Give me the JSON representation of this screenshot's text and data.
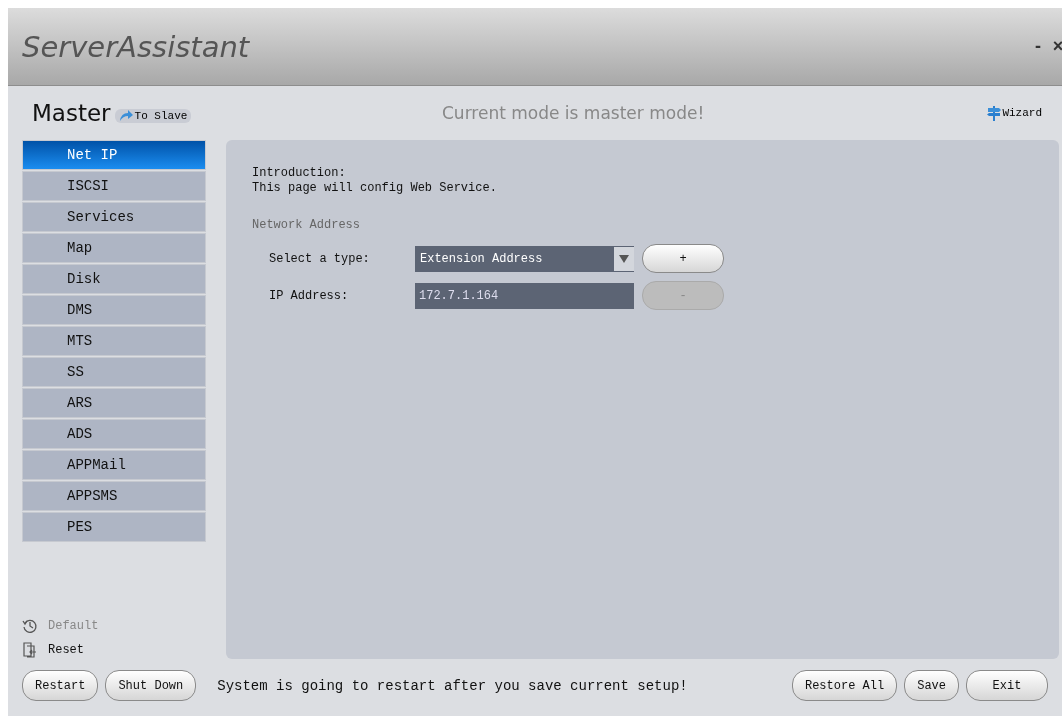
{
  "window": {
    "title": "ServerAssistant",
    "controls": [
      "-",
      "×"
    ]
  },
  "header": {
    "mode": "Master",
    "switch_link": "To Slave",
    "status": "Current mode is master mode!",
    "wizard": "Wizard"
  },
  "sidebar": {
    "items": [
      {
        "label": "Net IP",
        "selected": true
      },
      {
        "label": "ISCSI",
        "selected": false
      },
      {
        "label": "Services",
        "selected": false
      },
      {
        "label": "Map",
        "selected": false
      },
      {
        "label": "Disk",
        "selected": false
      },
      {
        "label": "DMS",
        "selected": false
      },
      {
        "label": "MTS",
        "selected": false
      },
      {
        "label": "SS",
        "selected": false
      },
      {
        "label": "ARS",
        "selected": false
      },
      {
        "label": "ADS",
        "selected": false
      },
      {
        "label": "APPMail",
        "selected": false
      },
      {
        "label": "APPSMS",
        "selected": false
      },
      {
        "label": "PES",
        "selected": false
      }
    ],
    "actions": [
      {
        "kind": "history",
        "label": "Default",
        "disabled": true
      },
      {
        "kind": "reset",
        "label": "Reset",
        "disabled": false
      }
    ]
  },
  "content": {
    "intro_title": "Introduction:",
    "intro_text": "This page will config Web Service.",
    "section": "Network Address",
    "rows": [
      {
        "kind": "select",
        "label": "Select a type:",
        "value": "Extension Address",
        "button": "+",
        "button_disabled": false
      },
      {
        "kind": "input",
        "label": "IP Address:",
        "value": "172.7.1.164",
        "button": "-",
        "button_disabled": true
      }
    ]
  },
  "footer": {
    "left_buttons": [
      "Restart",
      "Shut Down"
    ],
    "message": "System is going to restart after you save current setup!",
    "right_buttons": [
      "Restore All",
      "Save",
      "Exit"
    ]
  }
}
